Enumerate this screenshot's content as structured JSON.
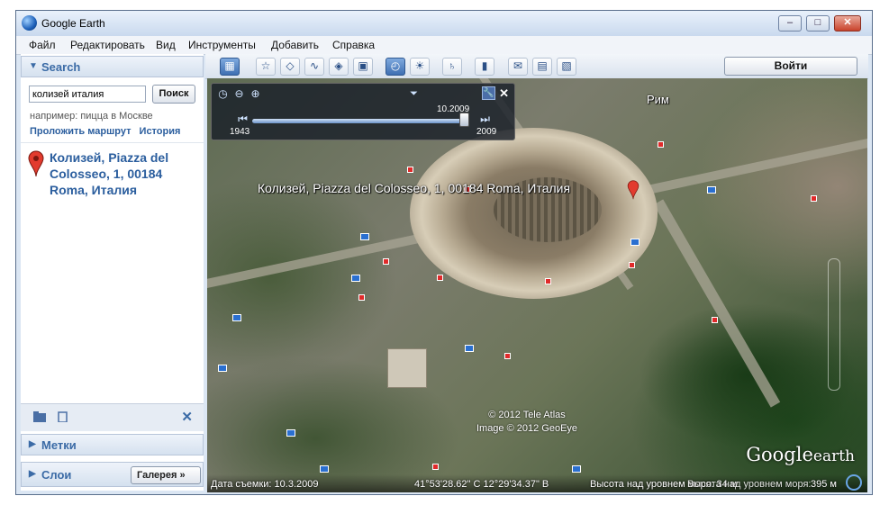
{
  "window": {
    "title": "Google Earth",
    "controls": {
      "minimize": "–",
      "maximize": "□",
      "close": "✕"
    }
  },
  "menu": [
    "Файл",
    "Редактировать",
    "Вид",
    "Инструменты",
    "Добавить",
    "Справка"
  ],
  "search": {
    "header": "Search",
    "value": "колизей италия",
    "button": "Поиск",
    "hint": "например: пицца в Москве",
    "link_route": "Проложить маршрут",
    "link_history": "История",
    "result": "Колизей, Piazza del Colosseo, 1, 00184 Roma, Италия"
  },
  "sidebar": {
    "places_header": "Метки",
    "layers_header": "Слои",
    "gallery_button": "Галерея »",
    "close_symbol": "✕"
  },
  "toolbar": {
    "login": "Войти",
    "icons": [
      "sidebar-toggle-icon",
      "add-placemark-icon",
      "add-polygon-icon",
      "add-path-icon",
      "add-overlay-icon",
      "record-tour-icon",
      "historical-imagery-icon",
      "sunlight-icon",
      "planets-icon",
      "ruler-icon",
      "email-icon",
      "print-icon",
      "view-in-maps-icon"
    ]
  },
  "time_slider": {
    "start_year": "1943",
    "end_year": "2009",
    "current": "10.2009",
    "progress": 0.98
  },
  "map": {
    "placemark_label": "Колизей, Piazza del Colosseo, 1, 00184 Roma, Италия",
    "city_label": "Рим",
    "copyright_1": "© 2012 Tele Atlas",
    "copyright_2": "Image © 2012 GeoEye",
    "logo_google": "Google",
    "logo_earth": "earth"
  },
  "status": {
    "date": "Дата съемки: 10.3.2009",
    "coords": "41°53'28.62\" С  12°29'34.37\" В",
    "elevation": "Высота над уровнем моря: 34 м",
    "altitude": "Высота над уровнем моря:",
    "eye_alt": "395 м"
  },
  "colors": {
    "accent": "#2b5e9e",
    "titlebar": "#c9d9ee",
    "close": "#c9432c"
  }
}
